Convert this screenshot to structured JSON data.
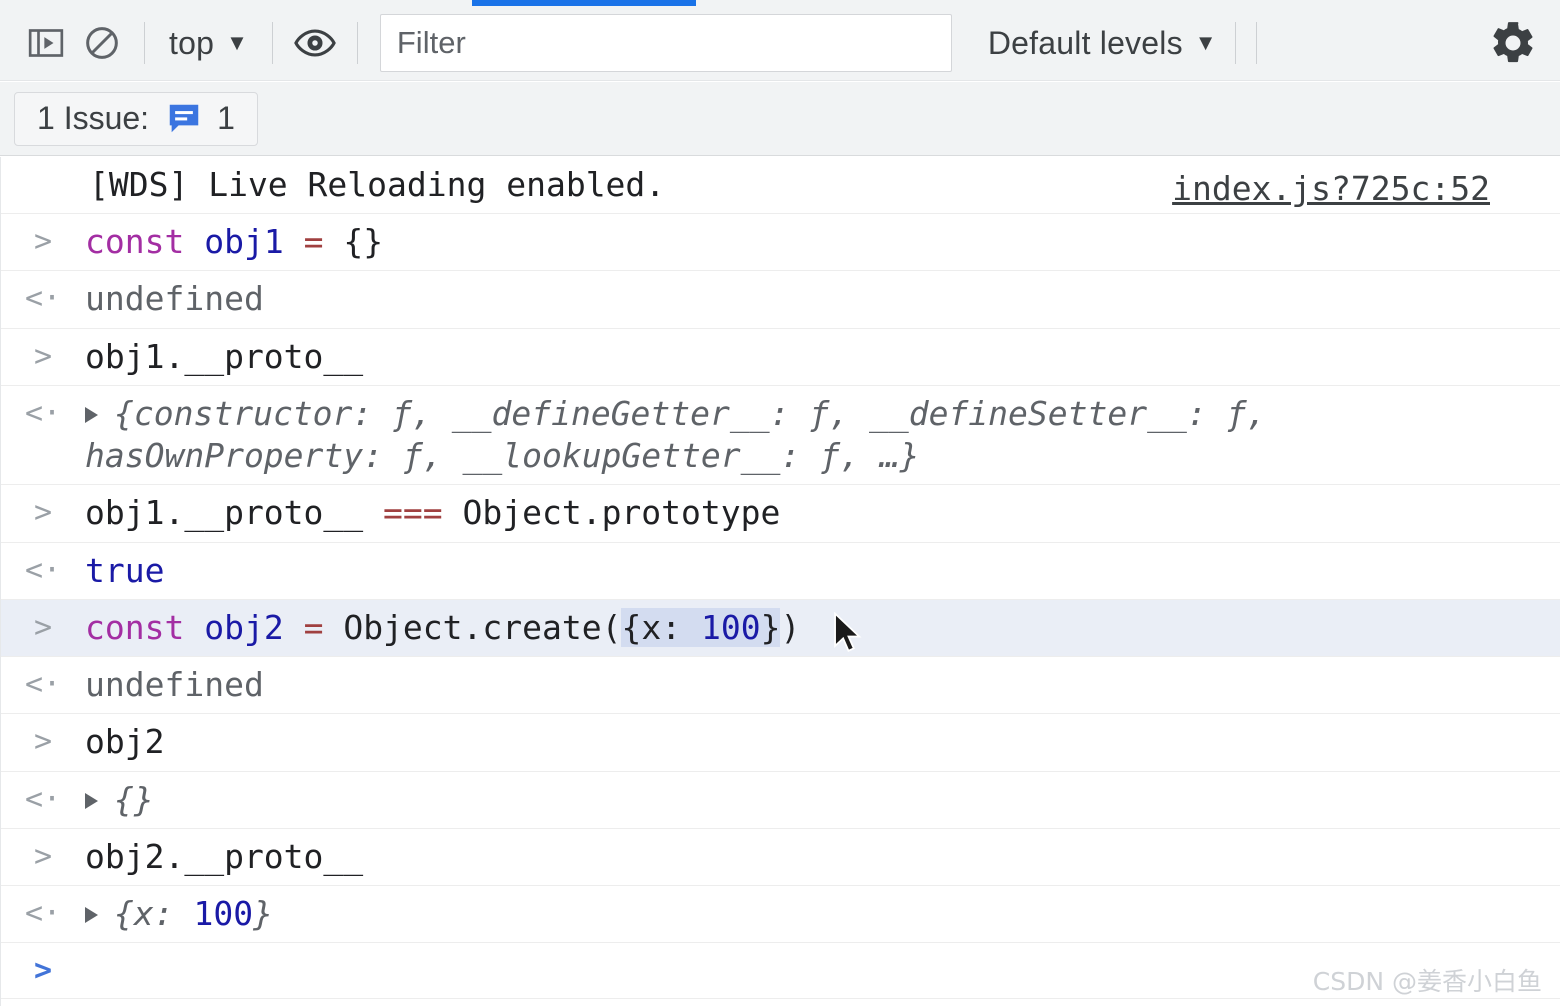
{
  "toolbar": {
    "sidebar_toggle_icon": "sidebar-panel-icon",
    "clear_console_icon": "clear-console-icon",
    "context_label": "top",
    "context_caret": "▼",
    "live_expression_icon": "eye-icon",
    "filter": {
      "value": "",
      "placeholder": "Filter"
    },
    "levels_label": "Default levels",
    "levels_caret": "▼",
    "settings_icon": "gear-icon"
  },
  "issues": {
    "label": "1 Issue:",
    "icon": "issue-message-icon",
    "count": "1",
    "icon_color": "#3b75e0"
  },
  "colors": {
    "accent_blue": "#1a73e8",
    "toolbar_bg": "#f1f3f4",
    "selected_row_bg": "#eaeef6",
    "selection_highlight": "#d3dcf0",
    "keyword_purple": "#a32ea3",
    "identifier_blue": "#1a1aa6",
    "operator_red": "#a04040",
    "muted_gray": "#5f6368"
  },
  "console": {
    "source_link": "index.js?725c:52",
    "gutter_input": ">",
    "gutter_output": "<·",
    "disclosure_icon": "disclosure-triangle-icon",
    "rows": [
      {
        "kind": "log",
        "text": "[WDS] Live Reloading enabled."
      },
      {
        "kind": "input",
        "segments": [
          {
            "t": "const",
            "c": "kw"
          },
          {
            "t": " ",
            "c": "plain"
          },
          {
            "t": "obj1",
            "c": "ident"
          },
          {
            "t": " ",
            "c": "plain"
          },
          {
            "t": "=",
            "c": "op"
          },
          {
            "t": " {}",
            "c": "plain"
          }
        ]
      },
      {
        "kind": "output",
        "segments": [
          {
            "t": "undefined",
            "c": "muted"
          }
        ]
      },
      {
        "kind": "input",
        "segments": [
          {
            "t": "obj1.__proto__",
            "c": "plain"
          }
        ]
      },
      {
        "kind": "output-object",
        "segments": [
          {
            "t": "{constructor: ƒ, __defineGetter__: ƒ, __defineSetter__: ƒ, hasOwnProperty: ƒ, __lookupGetter__: ƒ, …}",
            "c": "objprev"
          }
        ]
      },
      {
        "kind": "input",
        "segments": [
          {
            "t": "obj1.__proto__ ",
            "c": "plain"
          },
          {
            "t": "===",
            "c": "op"
          },
          {
            "t": " Object.prototype",
            "c": "plain"
          }
        ]
      },
      {
        "kind": "output",
        "segments": [
          {
            "t": "true",
            "c": "bool"
          }
        ]
      },
      {
        "kind": "input",
        "selected": true,
        "segments": [
          {
            "t": "const",
            "c": "kw"
          },
          {
            "t": " ",
            "c": "plain"
          },
          {
            "t": "obj2",
            "c": "ident"
          },
          {
            "t": " ",
            "c": "plain"
          },
          {
            "t": "=",
            "c": "op"
          },
          {
            "t": " Object.create(",
            "c": "plain"
          },
          {
            "t": "{x: ",
            "c": "plain sel-hl"
          },
          {
            "t": "100",
            "c": "num sel-hl"
          },
          {
            "t": "}",
            "c": "plain sel-hl"
          },
          {
            "t": ")",
            "c": "plain"
          }
        ]
      },
      {
        "kind": "output",
        "segments": [
          {
            "t": "undefined",
            "c": "muted"
          }
        ]
      },
      {
        "kind": "input",
        "segments": [
          {
            "t": "obj2",
            "c": "plain"
          }
        ]
      },
      {
        "kind": "output-object",
        "segments": [
          {
            "t": "{}",
            "c": "objprev"
          }
        ]
      },
      {
        "kind": "input",
        "segments": [
          {
            "t": "obj2.__proto__",
            "c": "plain"
          }
        ]
      },
      {
        "kind": "output-object",
        "segments": [
          {
            "t": "{x: ",
            "c": "objprev"
          },
          {
            "t": "100",
            "c": "num"
          },
          {
            "t": "}",
            "c": "objprev"
          }
        ]
      },
      {
        "kind": "prompt",
        "segments": []
      }
    ]
  },
  "watermark": "CSDN @姜香小白鱼"
}
